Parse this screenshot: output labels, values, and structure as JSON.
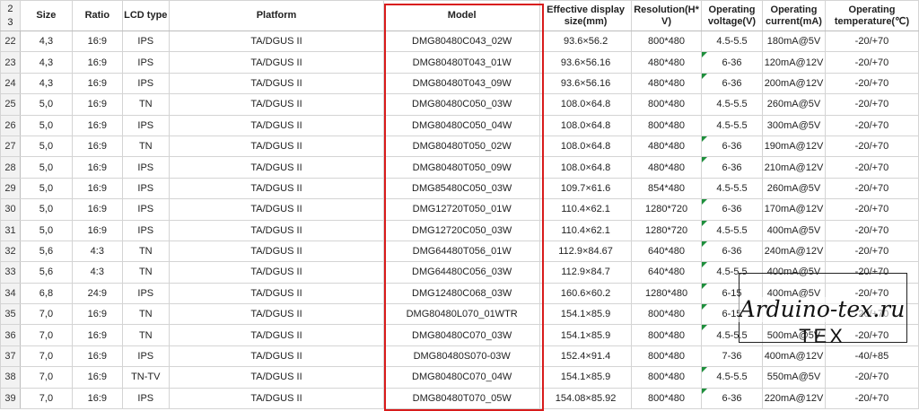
{
  "header": {
    "rownum_top": "2",
    "rownum_bottom": "3",
    "size": "Size",
    "ratio": "Ratio",
    "lcd_type": "LCD type",
    "platform": "Platform",
    "model": "Model",
    "display_size_1": "Effective display",
    "display_size_2": "size(mm)",
    "resolution_1": "Resolution(H*",
    "resolution_2": "V)",
    "voltage_1": "Operating",
    "voltage_2": "voltage(V)",
    "current_1": "Operating",
    "current_2": "current(mA)",
    "temp_1": "Operating",
    "temp_2": "temperature(℃)"
  },
  "rows": [
    {
      "num": "22",
      "size": "4,3",
      "ratio": "16:9",
      "lcd": "IPS",
      "platform": "TA/DGUS II",
      "model": "DMG80480C043_02W",
      "display": "93.6×56.2",
      "res": "800*480",
      "voltage": "4.5-5.5",
      "current": "180mA@5V",
      "temp": "-20/+70"
    },
    {
      "num": "23",
      "size": "4,3",
      "ratio": "16:9",
      "lcd": "IPS",
      "platform": "TA/DGUS II",
      "model": "DMG80480T043_01W",
      "display": "93.6×56.16",
      "res": "480*480",
      "voltage": "6-36",
      "current": "120mA@12V",
      "temp": "-20/+70"
    },
    {
      "num": "24",
      "size": "4,3",
      "ratio": "16:9",
      "lcd": "IPS",
      "platform": "TA/DGUS II",
      "model": "DMG80480T043_09W",
      "display": "93.6×56.16",
      "res": "480*480",
      "voltage": "6-36",
      "current": "200mA@12V",
      "temp": "-20/+70"
    },
    {
      "num": "25",
      "size": "5,0",
      "ratio": "16:9",
      "lcd": "TN",
      "platform": "TA/DGUS II",
      "model": "DMG80480C050_03W",
      "display": "108.0×64.8",
      "res": "800*480",
      "voltage": "4.5-5.5",
      "current": "260mA@5V",
      "temp": "-20/+70"
    },
    {
      "num": "26",
      "size": "5,0",
      "ratio": "16:9",
      "lcd": "IPS",
      "platform": "TA/DGUS II",
      "model": "DMG80480C050_04W",
      "display": "108.0×64.8",
      "res": "800*480",
      "voltage": "4.5-5.5",
      "current": "300mA@5V",
      "temp": "-20/+70"
    },
    {
      "num": "27",
      "size": "5,0",
      "ratio": "16:9",
      "lcd": "TN",
      "platform": "TA/DGUS II",
      "model": "DMG80480T050_02W",
      "display": "108.0×64.8",
      "res": "480*480",
      "voltage": "6-36",
      "current": "190mA@12V",
      "temp": "-20/+70"
    },
    {
      "num": "28",
      "size": "5,0",
      "ratio": "16:9",
      "lcd": "IPS",
      "platform": "TA/DGUS II",
      "model": "DMG80480T050_09W",
      "display": "108.0×64.8",
      "res": "480*480",
      "voltage": "6-36",
      "current": "210mA@12V",
      "temp": "-20/+70"
    },
    {
      "num": "29",
      "size": "5,0",
      "ratio": "16:9",
      "lcd": "IPS",
      "platform": "TA/DGUS II",
      "model": "DMG85480C050_03W",
      "display": "109.7×61.6",
      "res": "854*480",
      "voltage": "4.5-5.5",
      "current": "260mA@5V",
      "temp": "-20/+70"
    },
    {
      "num": "30",
      "size": "5,0",
      "ratio": "16:9",
      "lcd": "IPS",
      "platform": "TA/DGUS II",
      "model": "DMG12720T050_01W",
      "display": "110.4×62.1",
      "res": "1280*720",
      "voltage": "6-36",
      "current": "170mA@12V",
      "temp": "-20/+70"
    },
    {
      "num": "31",
      "size": "5,0",
      "ratio": "16:9",
      "lcd": "IPS",
      "platform": "TA/DGUS II",
      "model": "DMG12720C050_03W",
      "display": "110.4×62.1",
      "res": "1280*720",
      "voltage": "4.5-5.5",
      "current": "400mA@5V",
      "temp": "-20/+70"
    },
    {
      "num": "32",
      "size": "5,6",
      "ratio": "4:3",
      "lcd": "TN",
      "platform": "TA/DGUS II",
      "model": "DMG64480T056_01W",
      "display": "112.9×84.67",
      "res": "640*480",
      "voltage": "6-36",
      "current": "240mA@12V",
      "temp": "-20/+70"
    },
    {
      "num": "33",
      "size": "5,6",
      "ratio": "4:3",
      "lcd": "TN",
      "platform": "TA/DGUS II",
      "model": "DMG64480C056_03W",
      "display": "112.9×84.7",
      "res": "640*480",
      "voltage": "4.5-5.5",
      "current": "400mA@5V",
      "temp": "-20/+70"
    },
    {
      "num": "34",
      "size": "6,8",
      "ratio": "24:9",
      "lcd": "IPS",
      "platform": "TA/DGUS II",
      "model": "DMG12480C068_03W",
      "display": "160.6×60.2",
      "res": "1280*480",
      "voltage": "6-15",
      "current": "400mA@5V",
      "temp": "-20/+70"
    },
    {
      "num": "35",
      "size": "7,0",
      "ratio": "16:9",
      "lcd": "TN",
      "platform": "TA/DGUS II",
      "model": "DMG80480L070_01WTR",
      "display": "154.1×85.9",
      "res": "800*480",
      "voltage": "6-15",
      "current": "",
      "temp": "-20/+70"
    },
    {
      "num": "36",
      "size": "7,0",
      "ratio": "16:9",
      "lcd": "TN",
      "platform": "TA/DGUS II",
      "model": "DMG80480C070_03W",
      "display": "154.1×85.9",
      "res": "800*480",
      "voltage": "4.5-5.5",
      "current": "500mA@5V",
      "temp": "-20/+70"
    },
    {
      "num": "37",
      "size": "7,0",
      "ratio": "16:9",
      "lcd": "IPS",
      "platform": "TA/DGUS II",
      "model": "DMG80480S070-03W",
      "display": "152.4×91.4",
      "res": "800*480",
      "voltage": "7-36",
      "current": "400mA@12V",
      "temp": "-40/+85"
    },
    {
      "num": "38",
      "size": "7,0",
      "ratio": "16:9",
      "lcd": "TN-TV",
      "platform": "TA/DGUS II",
      "model": "DMG80480C070_04W",
      "display": "154.1×85.9",
      "res": "800*480",
      "voltage": "4.5-5.5",
      "current": "550mA@5V",
      "temp": "-20/+70"
    },
    {
      "num": "39",
      "size": "7,0",
      "ratio": "16:9",
      "lcd": "IPS",
      "platform": "TA/DGUS II",
      "model": "DMG80480T070_05W",
      "display": "154.08×85.92",
      "res": "800*480",
      "voltage": "6-36",
      "current": "220mA@12V",
      "temp": "-20/+70"
    }
  ],
  "flagged_rows": [
    "23",
    "24",
    "27",
    "28",
    "30",
    "31",
    "32",
    "33",
    "34",
    "35",
    "36",
    "38",
    "39"
  ],
  "colors": {
    "highlight_border": "#d81b1b",
    "comment_flag": "#1e8f3c"
  },
  "watermark": {
    "site": "Arduino-tex.ru",
    "logo": "TEX"
  }
}
